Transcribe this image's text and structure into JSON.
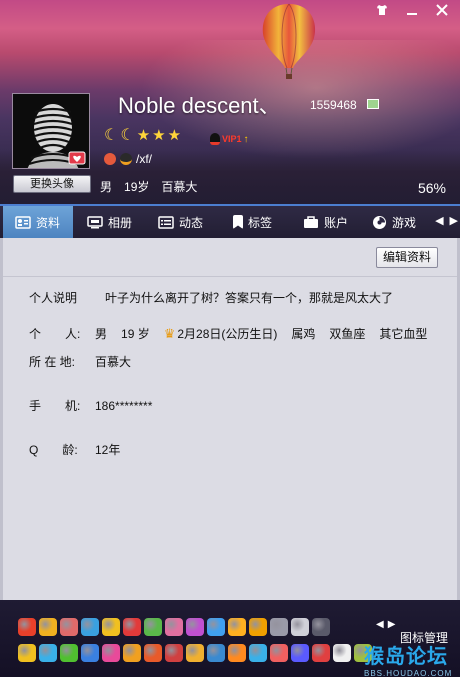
{
  "window": {
    "skin_icon": "shirt-icon",
    "minimize_icon": "minimize-icon",
    "close_icon": "close-icon"
  },
  "profile": {
    "nickname": "Noble descent、",
    "qq_number": "1559468",
    "signature": "/xf/",
    "gender": "男",
    "age": "19岁",
    "location": "百慕大",
    "completion": "56%",
    "change_avatar_label": "更换头像",
    "vip_label": "VIP1"
  },
  "tabs": [
    {
      "label": "资料",
      "icon": "profile-card-icon"
    },
    {
      "label": "相册",
      "icon": "album-icon"
    },
    {
      "label": "动态",
      "icon": "feed-icon"
    },
    {
      "label": "标签",
      "icon": "tag-icon"
    },
    {
      "label": "账户",
      "icon": "wallet-icon"
    },
    {
      "label": "游戏",
      "icon": "game-icon"
    }
  ],
  "content": {
    "edit_label": "编辑资料",
    "personal_note_label": "个人说明",
    "personal_note": "叶子为什么离开了树？答案只有一个，那就是风太大了",
    "person_label": "个　　人:",
    "person_gender": "男",
    "person_age": "19 岁",
    "person_birthday": "2月28日(公历生日)",
    "person_zodiac": "属鸡",
    "person_constellation": "双鱼座",
    "person_blood": "其它血型",
    "location_label": "所 在 地:",
    "location_value": "百慕大",
    "phone_label": "手　　机:",
    "phone_value": "186********",
    "qage_label": "Q　　龄:",
    "qage_value": "12年"
  },
  "bottom": {
    "manage_label": "图标管理",
    "watermark_main": "猴岛论坛",
    "watermark_sub": "BBS.HOUDAO.COM",
    "row1_colors": [
      "#e8402a",
      "#f0b020",
      "#e06a6a",
      "#3aa0e0",
      "#f0c020",
      "#e23a3a",
      "#5ab84a",
      "#e070a0",
      "#c050d0",
      "#40a0f0",
      "#ffb020",
      "#f0a000",
      "#9a9aa8",
      "#d0d0d8",
      "#5a5a6a"
    ],
    "row2_colors": [
      "#f0c020",
      "#3ab0e8",
      "#50c030",
      "#3a80e0",
      "#e84a9a",
      "#f0a020",
      "#e85a2a",
      "#d04040",
      "#f0b030",
      "#3a8ad0",
      "#ff8a20",
      "#3ab0e8",
      "#f06060",
      "#5a5aff",
      "#e04040",
      "#f0f0f0",
      "#a0c040"
    ]
  }
}
